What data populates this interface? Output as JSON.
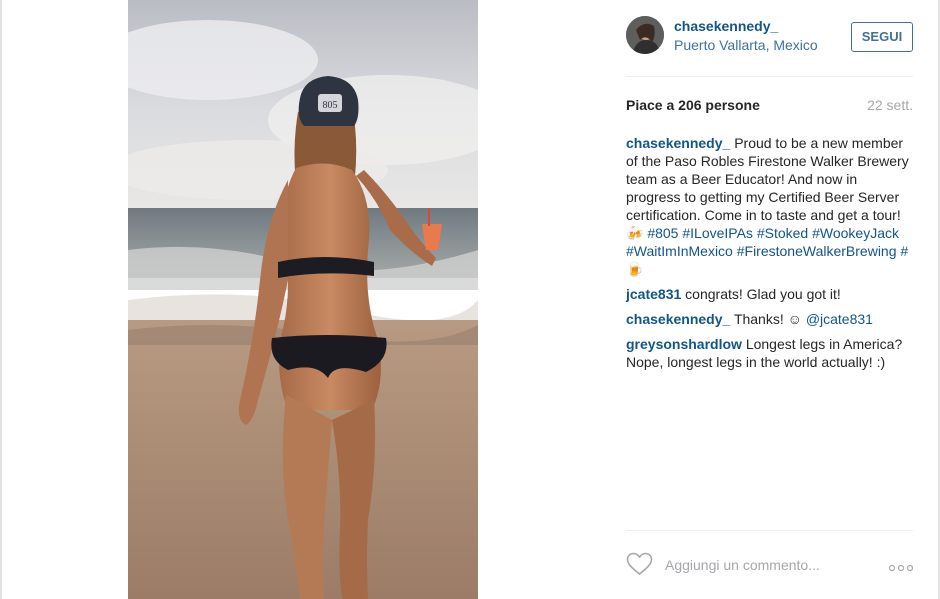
{
  "post": {
    "username": "chasekennedy_",
    "location": "Puerto Vallarta, Mexico",
    "follow_label": "SEGUI",
    "likes": "Piace a 206 persone",
    "date": "22 sett."
  },
  "comments": [
    {
      "user": "chasekennedy_",
      "text_1": "Proud to be a new member of the Paso Robles Firestone Walker Brewery team as a Beer Educator! And now in progress to getting my Certified Beer Server certification. Come in to taste and get a tour! ",
      "emoji_1": "🍻",
      "tag_1": "#805",
      "tag_2": "#ILoveIPAs",
      "tag_3": "#Stoked",
      "tag_4": "#WookeyJack",
      "tag_5": "#WaitImInMexico",
      "tag_6": "#FirestoneWalkerBrewing",
      "tag_7": "#",
      "emoji_2": "🍺"
    },
    {
      "user": "jcate831",
      "text": "congrats! Glad you got it!"
    },
    {
      "user": "chasekennedy_",
      "text": "Thanks! ☺ ",
      "mention": "@jcate831"
    },
    {
      "user": "greysonshardlow",
      "text": "Longest legs in America? Nope, longest legs in the world actually! :)"
    }
  ],
  "composer": {
    "placeholder": "Aggiungi un commento...",
    "like_icon": "heart-outline-icon",
    "more_icon": "ellipsis-icon"
  },
  "photo": {
    "cap_text": "805"
  },
  "colors": {
    "link": "#125688",
    "location": "#3f729b",
    "muted": "#a5a7aa"
  }
}
